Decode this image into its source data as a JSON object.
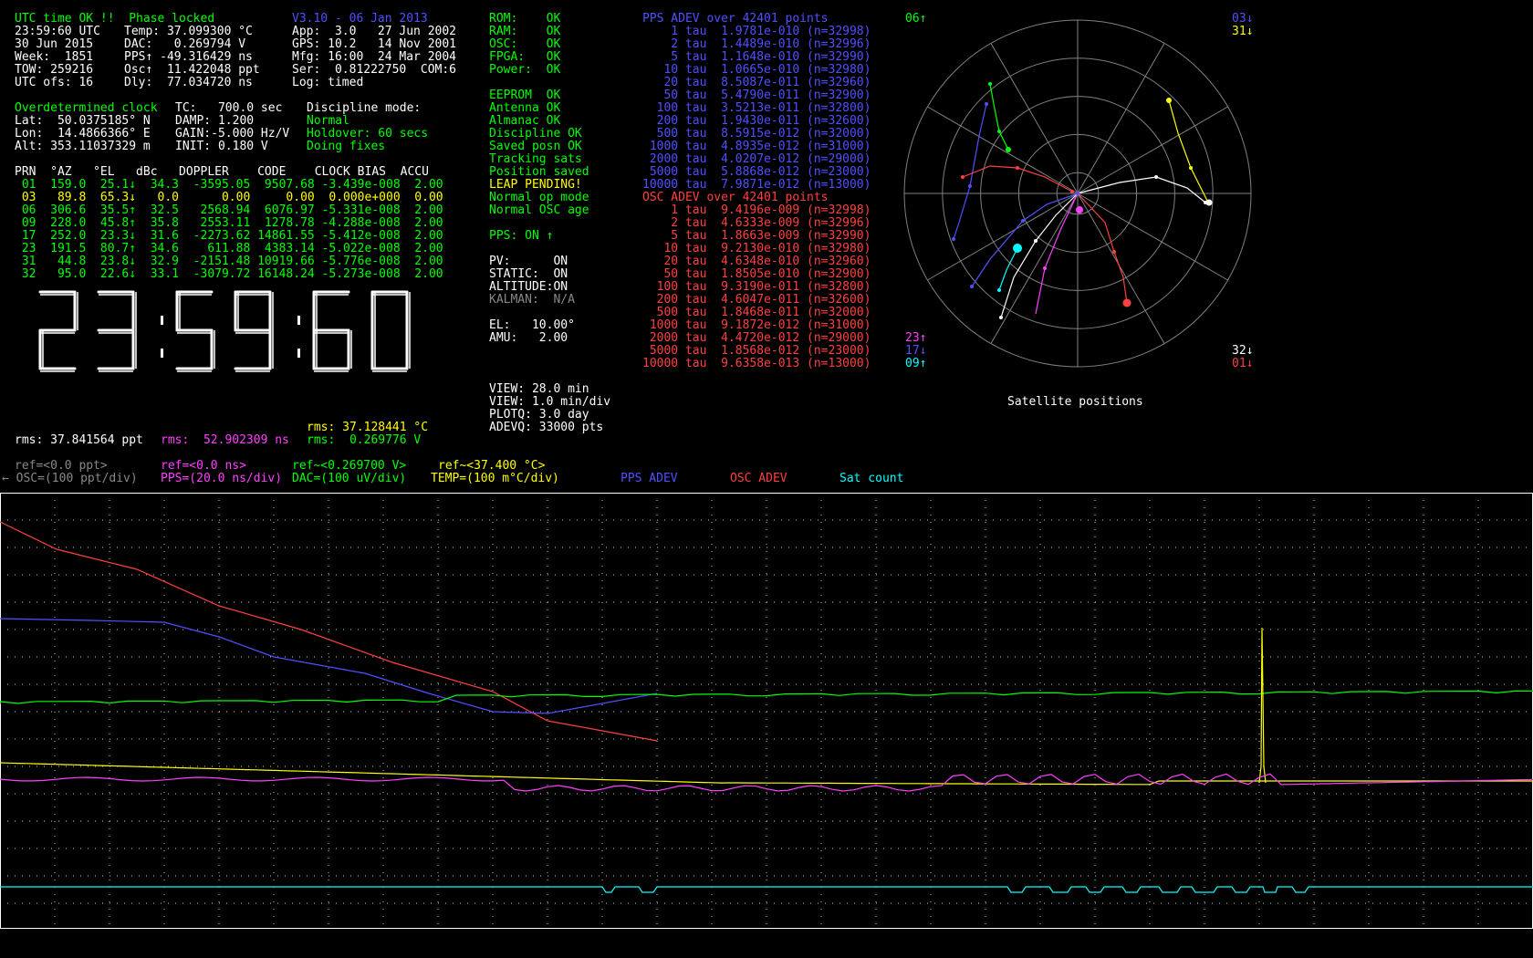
{
  "status": [
    "UTC time OK !!  Phase locked",
    "23:59:60 UTC",
    "30 Jun 2015",
    "Week:  1851",
    "TOW: 259216",
    "UTC ofs: 16"
  ],
  "status_right": [
    "",
    "Temp: 37.099300 °C",
    "DAC:   0.269794 V",
    "PPS↑ -49.316429 ns",
    "Osc↑  11.422048 ppt",
    "Dly:  77.034720 ns"
  ],
  "version": [
    "V3.10 - 06 Jan 2013",
    "App:  3.0   27 Jun 2002",
    "GPS: 10.2   14 Nov 2001",
    "Mfg: 16:00  24 Mar 2004",
    "Ser:  0.81222750  COM:6",
    "Log: timed"
  ],
  "discipline": {
    "title": "Overdetermined clock",
    "tc": "TC:   700.0 sec",
    "mode_label": "Discipline mode:",
    "lat": "Lat:  50.0375185° N",
    "lon": "Lon:  14.4866366° E",
    "alt": "Alt: 353.11037329 m",
    "damp": "DAMP: 1.200",
    "gain": "GAIN:-5.000 Hz/V",
    "init": "INIT: 0.180 V",
    "mode1": "Normal",
    "mode2": "Holdover: 60 secs",
    "mode3": "Doing fixes"
  },
  "sat_table": {
    "header": "PRN  °AZ   °EL   dBc   DOPPLER    CODE    CLOCK BIAS  ACCU",
    "rows": [
      {
        "text": " 01  159.0  25.1↓  34.3  -3595.05  9507.68 -3.439e-008  2.00",
        "color": "#00ff00"
      },
      {
        "text": " 03   89.8  65.3↓   0.0      0.00     0.00  0.000e+000  0.00",
        "color": "#ffff00"
      },
      {
        "text": " 06  306.6  35.5↑  32.5   2568.94  6076.97 -5.331e-008  2.00",
        "color": "#00ff00"
      },
      {
        "text": " 09  228.0  45.8↑  35.8   2553.11  1278.78 -4.288e-008  2.00",
        "color": "#00ff00"
      },
      {
        "text": " 17  252.0  23.3↓  31.6  -2273.62 14861.55 -5.412e-008  2.00",
        "color": "#00ff00"
      },
      {
        "text": " 23  191.5  80.7↑  34.6    611.88  4383.14 -5.022e-008  2.00",
        "color": "#00ff00"
      },
      {
        "text": " 31   44.8  23.8↓  32.9  -2151.48 10919.66 -5.776e-008  2.00",
        "color": "#00ff00"
      },
      {
        "text": " 32   95.0  22.6↓  33.1  -3079.72 16148.24 -5.273e-008  2.00",
        "color": "#00ff00"
      }
    ]
  },
  "big_clock": "23:59:60",
  "health": {
    "items": [
      {
        "text": "ROM:    OK",
        "color": "#00ff00"
      },
      {
        "text": "RAM:    OK",
        "color": "#00ff00"
      },
      {
        "text": "OSC:    OK",
        "color": "#00ff00"
      },
      {
        "text": "FPGA:   OK",
        "color": "#00ff00"
      },
      {
        "text": "Power:  OK",
        "color": "#00ff00"
      },
      {
        "text": "",
        "color": "#00ff00"
      },
      {
        "text": "EEPROM  OK",
        "color": "#00ff00"
      },
      {
        "text": "Antenna OK",
        "color": "#00ff00"
      },
      {
        "text": "Almanac OK",
        "color": "#00ff00"
      },
      {
        "text": "Discipline OK",
        "color": "#00ff00"
      },
      {
        "text": "Saved posn OK",
        "color": "#00ff00"
      },
      {
        "text": "Tracking sats",
        "color": "#00ff00"
      },
      {
        "text": "Position saved",
        "color": "#00ff00"
      },
      {
        "text": "LEAP PENDING!",
        "color": "#ffff00"
      },
      {
        "text": "Normal op mode",
        "color": "#00ff00"
      },
      {
        "text": "Normal OSC age",
        "color": "#00ff00"
      },
      {
        "text": "",
        "color": "#00ff00"
      },
      {
        "text": "PPS: ON ↑",
        "color": "#00ff00"
      }
    ],
    "modes": [
      {
        "text": "PV:      ON",
        "color": "#ffffff"
      },
      {
        "text": "STATIC:  ON",
        "color": "#ffffff"
      },
      {
        "text": "ALTITUDE:ON",
        "color": "#ffffff"
      },
      {
        "text": "KALMAN:  N/A",
        "color": "#888888"
      },
      {
        "text": "",
        "color": "#ffffff"
      },
      {
        "text": "EL:   10.00°",
        "color": "#ffffff"
      },
      {
        "text": "AMU:   2.00",
        "color": "#ffffff"
      }
    ],
    "view": [
      "VIEW: 28.0 min",
      "VIEW: 1.0 min/div",
      "PLOTQ: 3.0 day",
      "ADEVQ: 33000 pts"
    ]
  },
  "pps_adev": {
    "title": "PPS ADEV over 42401 points",
    "rows": [
      "    1 tau  1.9781e-010 (n=32998)",
      "    2 tau  1.4489e-010 (n=32996)",
      "    5 tau  1.1648e-010 (n=32990)",
      "   10 tau  1.0665e-010 (n=32980)",
      "   20 tau  8.5087e-011 (n=32960)",
      "   50 tau  5.4790e-011 (n=32900)",
      "  100 tau  3.5213e-011 (n=32800)",
      "  200 tau  1.9430e-011 (n=32600)",
      "  500 tau  8.5915e-012 (n=32000)",
      " 1000 tau  4.8935e-012 (n=31000)",
      " 2000 tau  4.0207e-012 (n=29000)",
      " 5000 tau  5.8868e-012 (n=23000)",
      "10000 tau  7.9871e-012 (n=13000)"
    ]
  },
  "osc_adev": {
    "title": "OSC ADEV over 42401 points",
    "rows": [
      "    1 tau  9.4196e-009 (n=32998)",
      "    2 tau  4.6333e-009 (n=32996)",
      "    5 tau  1.8663e-009 (n=32990)",
      "   10 tau  9.2130e-010 (n=32980)",
      "   20 tau  4.6348e-010 (n=32960)",
      "   50 tau  1.8505e-010 (n=32900)",
      "  100 tau  9.3190e-011 (n=32800)",
      "  200 tau  4.6047e-011 (n=32600)",
      "  500 tau  1.8468e-011 (n=32000)",
      " 1000 tau  9.1872e-012 (n=31000)",
      " 2000 tau  4.4720e-012 (n=29000)",
      " 5000 tau  1.8568e-012 (n=23000)",
      "10000 tau  9.6358e-013 (n=13000)"
    ]
  },
  "sky": {
    "caption": "Satellite positions",
    "labels": [
      {
        "text": "06↑",
        "color": "#00ff00",
        "pos": "tl"
      },
      {
        "text": "03↓",
        "color": "#5050ff",
        "pos": "tr"
      },
      {
        "text": "31↓",
        "color": "#ffff00",
        "pos": "tr2"
      },
      {
        "text": "23↑",
        "color": "#ff40ff",
        "pos": "bl1"
      },
      {
        "text": "17↓",
        "color": "#5050ff",
        "pos": "bl2"
      },
      {
        "text": "09↑",
        "color": "#00ffff",
        "pos": "bl3"
      },
      {
        "text": "32↓",
        "color": "#ffffff",
        "pos": "br1"
      },
      {
        "text": "01↓",
        "color": "#ff4040",
        "pos": "br2"
      }
    ]
  },
  "rms": {
    "temp": "rms: 37.128441 °C",
    "osc": "rms: 37.841564 ppt",
    "pps": "rms:  52.902309 ns",
    "dac": "rms:  0.269776 V"
  },
  "legend": {
    "row1": [
      {
        "text": "ref=<0.0 ppt>",
        "color": "#888888"
      },
      {
        "text": "ref=<0.0 ns>",
        "color": "#ff40ff"
      },
      {
        "text": "ref~<0.269700 V>",
        "color": "#00ff00"
      },
      {
        "text": "ref~<37.400 °C>",
        "color": "#ffff00"
      }
    ],
    "row2": [
      {
        "text": "← OSC=(100 ppt/div)",
        "color": "#888888"
      },
      {
        "text": "PPS=(20.0 ns/div)",
        "color": "#ff40ff"
      },
      {
        "text": "DAC=(100 uV/div)",
        "color": "#00ff00"
      },
      {
        "text": "TEMP=(100 m°C/div)",
        "color": "#ffff00"
      },
      {
        "text": "PPS ADEV",
        "color": "#5050ff"
      },
      {
        "text": "OSC ADEV",
        "color": "#ff4040"
      },
      {
        "text": "Sat count",
        "color": "#00ffff"
      }
    ]
  },
  "colors": {
    "pps": "#ff40ff",
    "dac": "#00ff00",
    "temp": "#ffff00",
    "pps_adev": "#5050ff",
    "osc_adev": "#ff4040",
    "sat": "#00ffff",
    "grid": "#ffffff"
  }
}
